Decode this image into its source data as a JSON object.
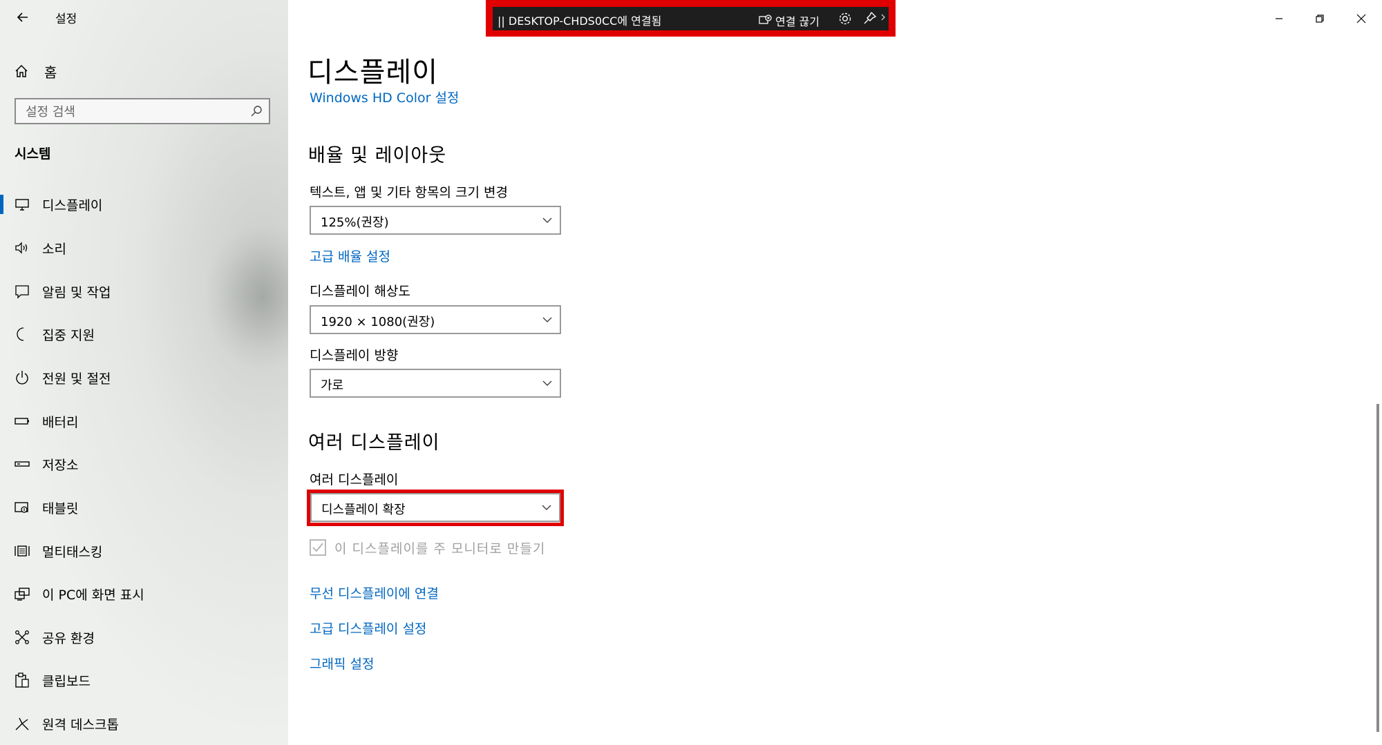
{
  "window": {
    "app_title": "설정",
    "controls": {
      "minimize": "minimize-icon",
      "restore": "restore-icon",
      "close": "close-icon"
    }
  },
  "connection_bar": {
    "title": "|| DESKTOP-CHDS0CC에 연결됨",
    "disconnect_label": "연결 끊기",
    "icons": [
      "disconnect-icon",
      "gear-icon",
      "pin-icon",
      "chevron-right-icon"
    ]
  },
  "sidebar": {
    "home_label": "홈",
    "search_placeholder": "설정 검색",
    "section_title": "시스템",
    "items": [
      {
        "label": "디스플레이",
        "icon": "monitor-icon",
        "active": true
      },
      {
        "label": "소리",
        "icon": "speaker-icon"
      },
      {
        "label": "알림 및 작업",
        "icon": "notification-icon"
      },
      {
        "label": "집중 지원",
        "icon": "moon-icon"
      },
      {
        "label": "전원 및 절전",
        "icon": "power-icon"
      },
      {
        "label": "배터리",
        "icon": "battery-icon"
      },
      {
        "label": "저장소",
        "icon": "storage-icon"
      },
      {
        "label": "태블릿",
        "icon": "tablet-icon"
      },
      {
        "label": "멀티태스킹",
        "icon": "multitasking-icon"
      },
      {
        "label": "이 PC에 화면 표시",
        "icon": "project-icon"
      },
      {
        "label": "공유 환경",
        "icon": "shared-experiences-icon"
      },
      {
        "label": "클립보드",
        "icon": "clipboard-icon"
      },
      {
        "label": "원격 데스크톱",
        "icon": "remote-desktop-icon"
      }
    ]
  },
  "main": {
    "title": "디스플레이",
    "hd_color_link": "Windows HD Color 설정",
    "scale_section": {
      "heading": "배율 및 레이아웃",
      "scale_label": "텍스트, 앱 및 기타 항목의 크기 변경",
      "scale_value": "125%(권장)",
      "advanced_scaling_link": "고급 배율 설정",
      "resolution_label": "디스플레이 해상도",
      "resolution_value": "1920 × 1080(권장)",
      "orientation_label": "디스플레이 방향",
      "orientation_value": "가로"
    },
    "multi_section": {
      "heading": "여러 디스플레이",
      "multi_label": "여러 디스플레이",
      "multi_value": "디스플레이 확장",
      "main_display_checkbox": "이 디스플레이를 주 모니터로 만들기",
      "main_display_checked": true,
      "wireless_link": "무선 디스플레이에 연결",
      "advanced_display_link": "고급 디스플레이 설정",
      "graphics_link": "그래픽 설정"
    }
  },
  "colors": {
    "accent": "#0067c0",
    "highlight": "#e00000",
    "connection_bar_bg": "#1e1e1e"
  }
}
